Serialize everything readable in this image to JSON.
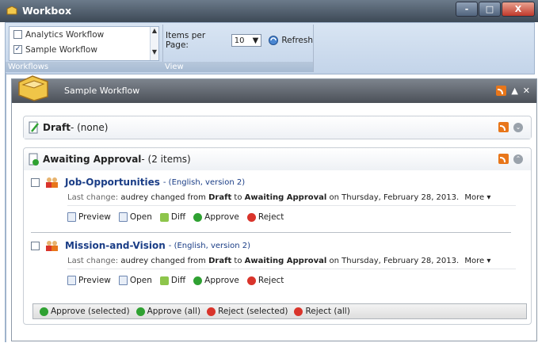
{
  "window": {
    "title": "Workbox",
    "controls": [
      "-",
      "□",
      "X"
    ]
  },
  "ribbon": {
    "workflows": {
      "group_label": "Workflows",
      "items": [
        {
          "label": "Analytics Workflow",
          "checked": false
        },
        {
          "label": "Sample Workflow",
          "checked": true
        }
      ]
    },
    "view": {
      "group_label": "View",
      "items_per_page_label": "Items per Page:",
      "items_per_page_value": "10",
      "refresh_label": "Refresh"
    }
  },
  "panel": {
    "title": "Sample Workflow",
    "sections": [
      {
        "state": "Draft",
        "suffix": " - (none)"
      },
      {
        "state": "Awaiting Approval",
        "suffix": " - (2 items)"
      }
    ],
    "items": [
      {
        "title": "Job-Opportunities",
        "meta": " - (English, version 2)",
        "last_change_label": "Last change:",
        "last_change_text": " audrey changed from ",
        "from_state": "Draft",
        "to_word": " to ",
        "to_state": "Awaiting Approval",
        "on_text": " on Thursday, February 28, 2013.",
        "more_label": "More"
      },
      {
        "title": "Mission-and-Vision",
        "meta": " - (English, version 2)",
        "last_change_label": "Last change:",
        "last_change_text": " audrey changed from ",
        "from_state": "Draft",
        "to_word": " to ",
        "to_state": "Awaiting Approval",
        "on_text": " on Thursday, February 28, 2013.",
        "more_label": "More"
      }
    ],
    "actions": {
      "preview": "Preview",
      "open": "Open",
      "diff": "Diff",
      "approve": "Approve",
      "reject": "Reject"
    },
    "bulk_actions": {
      "approve_selected": "Approve (selected)",
      "approve_all": "Approve (all)",
      "reject_selected": "Reject (selected)",
      "reject_all": "Reject (all)"
    }
  },
  "colors": {
    "accent_blue": "#1a3d86",
    "rss_orange": "#e8761a",
    "approve_green": "#2fa132",
    "reject_red": "#d9342b"
  }
}
